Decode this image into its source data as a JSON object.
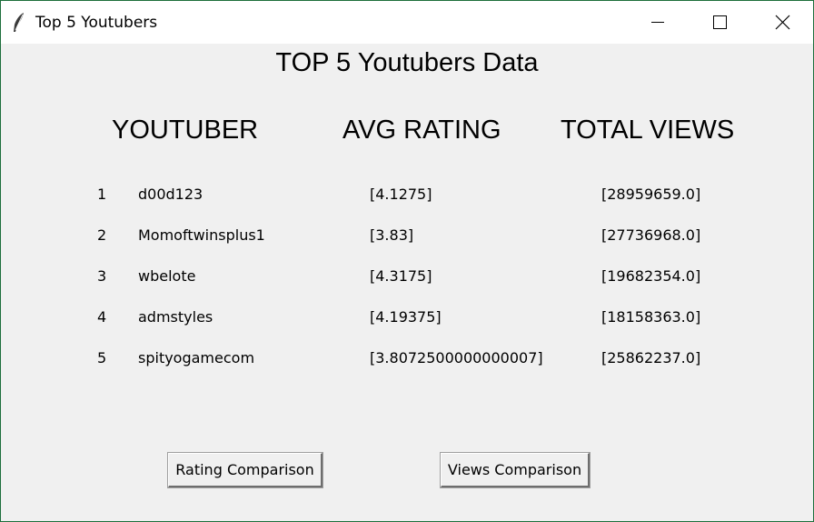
{
  "window": {
    "title": "Top 5 Youtubers",
    "icon": "feather-icon",
    "controls": [
      "minimize-icon",
      "maximize-icon",
      "close-icon"
    ]
  },
  "heading": "TOP 5 Youtubers Data",
  "columns": {
    "youtuber": "YOUTUBER",
    "avg_rating": "AVG RATING",
    "total_views": "TOTAL VIEWS"
  },
  "rows": [
    {
      "rank": "1",
      "name": "d00d123",
      "rating": "[4.1275]",
      "views": "[28959659.0]"
    },
    {
      "rank": "2",
      "name": "Momoftwinsplus1",
      "rating": "[3.83]",
      "views": "[27736968.0]"
    },
    {
      "rank": "3",
      "name": "wbelote",
      "rating": "[4.3175]",
      "views": "[19682354.0]"
    },
    {
      "rank": "4",
      "name": "admstyles",
      "rating": "[4.19375]",
      "views": "[18158363.0]"
    },
    {
      "rank": "5",
      "name": "spityogamecom",
      "rating": "[3.8072500000000007]",
      "views": "[25862237.0]"
    }
  ],
  "buttons": {
    "rating_comparison": "Rating Comparison",
    "views_comparison": "Views Comparison"
  }
}
